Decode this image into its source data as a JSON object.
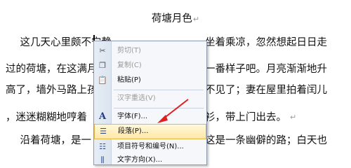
{
  "document": {
    "title": "荷塘月色",
    "lines": [
      {
        "left_text": "　这几天心里颇不宁静",
        "right_text": "坐着乘凉，忽然想起日日走"
      },
      {
        "left_text": "过的荷塘，在这满月",
        "right_text": "一番样子吧。月亮渐渐地升"
      },
      {
        "left_text": "高了，墙外马路上孩",
        "right_text": "不见了；妻在屋里拍着闰儿"
      },
      {
        "left_text": "，迷迷糊糊地哼着",
        "right_text": "衫，带上门出去。"
      },
      {
        "left_text": "　沿着荷塘，是一",
        "right_text": "这是一条幽僻的路；白天也"
      }
    ],
    "paragraph_mark": "↵"
  },
  "context_menu": {
    "items": [
      {
        "label": "剪切(T)",
        "icon": "scissors-icon",
        "glyph": "✂",
        "enabled": false
      },
      {
        "label": "复制(C)",
        "icon": "copy-icon",
        "glyph": "❐",
        "enabled": false
      },
      {
        "label": "粘贴(P)",
        "icon": "paste-icon",
        "glyph": "📋",
        "enabled": true
      },
      {
        "label": "汉字重选(V)",
        "icon": "",
        "glyph": "",
        "enabled": false
      },
      {
        "label": "字体(F)...",
        "icon": "font-icon",
        "glyph": "A",
        "enabled": true
      },
      {
        "label": "段落(P)...",
        "icon": "paragraph-icon",
        "glyph": "☰",
        "enabled": true,
        "highlighted": true
      },
      {
        "label": "项目符号和编号(N)...",
        "icon": "bullets-icon",
        "glyph": "☷",
        "enabled": true
      },
      {
        "label": "文字方向(X)...",
        "icon": "text-direction-icon",
        "glyph": "⫼",
        "enabled": true
      }
    ]
  },
  "colors": {
    "highlight": "#ffe8a6",
    "arrow": "#e02020"
  }
}
